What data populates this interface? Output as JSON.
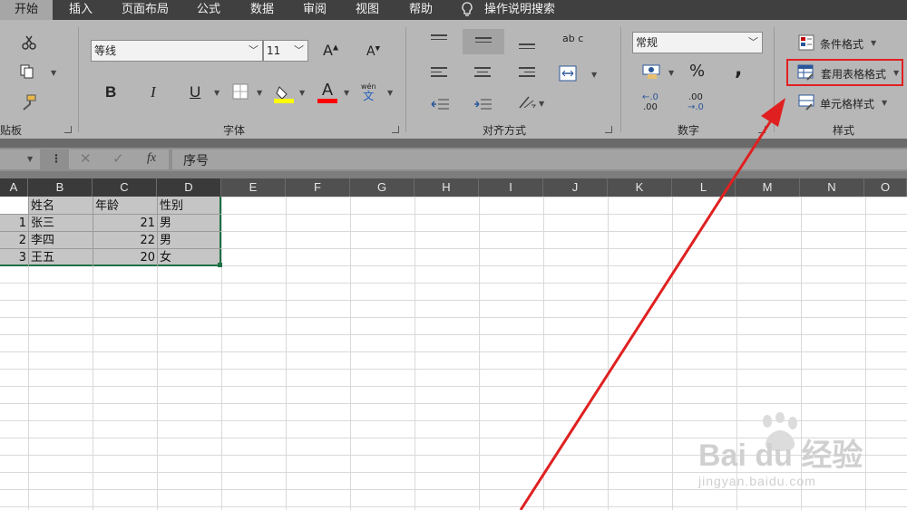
{
  "tabs": [
    {
      "label": "开始",
      "active": true
    },
    {
      "label": "插入"
    },
    {
      "label": "页面布局"
    },
    {
      "label": "公式"
    },
    {
      "label": "数据"
    },
    {
      "label": "审阅"
    },
    {
      "label": "视图"
    },
    {
      "label": "帮助"
    },
    {
      "label": "操作说明搜索"
    }
  ],
  "ribbon": {
    "clipboard_label": "贴板",
    "font": {
      "name": "等线",
      "size": "11",
      "grow": "A",
      "shrink": "A",
      "bold": "B",
      "italic": "I",
      "underline": "U",
      "font_color": "A",
      "phonetic_top": "wén",
      "phonetic_bottom": "文",
      "group_label": "字体"
    },
    "alignment": {
      "orient_glyph": "ab c",
      "group_label": "对齐方式"
    },
    "number": {
      "format": "常规",
      "percent": "%",
      "comma": ",",
      "inc_decimal_top": "←.0",
      "inc_decimal_bottom": ".00",
      "dec_decimal_top": ".00",
      "dec_decimal_bottom": "→.0",
      "group_label": "数字"
    },
    "styles": {
      "conditional": "条件格式",
      "table_format": "套用表格格式",
      "cell_styles": "单元格样式",
      "group_label": "样式"
    }
  },
  "formula_bar": {
    "fx": "fx",
    "content": "序号"
  },
  "columns": [
    "A",
    "B",
    "C",
    "D",
    "E",
    "F",
    "G",
    "H",
    "I",
    "J",
    "K",
    "L",
    "M",
    "N",
    "O"
  ],
  "table": {
    "headers": [
      "",
      "姓名",
      "年龄",
      "性别"
    ],
    "rows": [
      [
        "1",
        "张三",
        "21",
        "男"
      ],
      [
        "2",
        "李四",
        "22",
        "男"
      ],
      [
        "3",
        "王五",
        "20",
        "女"
      ]
    ]
  },
  "watermark": {
    "brand": "Bai  du 经验",
    "url": "jingyan.baidu.com"
  },
  "colors": {
    "highlight_box": "#e02020",
    "arrow": "#e02020",
    "selection_border": "#1e7145"
  }
}
